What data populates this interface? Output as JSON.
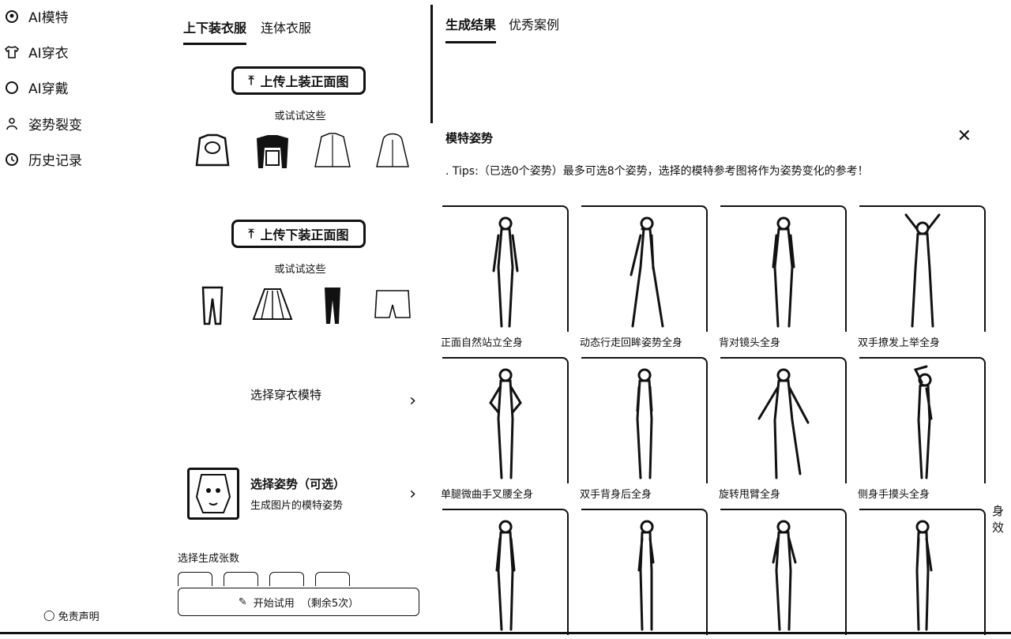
{
  "sidebar": {
    "items": [
      {
        "label": "AI模特",
        "icon": "model-icon"
      },
      {
        "label": "AI穿衣",
        "icon": "shirt-icon"
      },
      {
        "label": "AI穿戴",
        "icon": "ring-icon"
      },
      {
        "label": "姿势裂变",
        "icon": "pose-icon"
      },
      {
        "label": "历史记录",
        "icon": "history-icon"
      }
    ],
    "footer": "免责声明"
  },
  "mid": {
    "tabs": [
      "上下装衣服",
      "连体衣服"
    ],
    "upload_top": "上传上装正面图",
    "upload_bottom": "上传下装正面图",
    "try_label_top": "或试试这些",
    "try_label_bottom": "或试试这些",
    "select_model": "选择穿衣模特",
    "select_pose_title": "选择姿势（可选）",
    "select_pose_sub": "生成图片的模特姿势",
    "count_label": "选择生成张数",
    "start_label": "开始试用",
    "start_remaining": "（剩余5次）"
  },
  "right": {
    "tabs": [
      "生成结果",
      "优秀案例"
    ]
  },
  "modal": {
    "title": "模特姿势",
    "tips": ". Tips:（已选0个姿势）最多可选8个姿势，选择的模特参考图将作为姿势变化的参考！",
    "poses": [
      "正面自然站立全身",
      "动态行走回眸姿势全身",
      "背对镜头全身",
      "双手撩发上举全身",
      "单腿微曲手叉腰全身",
      "双手背身后全身",
      "旋转甩臂全身",
      "侧身手摸头全身",
      "",
      "",
      "",
      ""
    ],
    "edge_label": "身效"
  }
}
